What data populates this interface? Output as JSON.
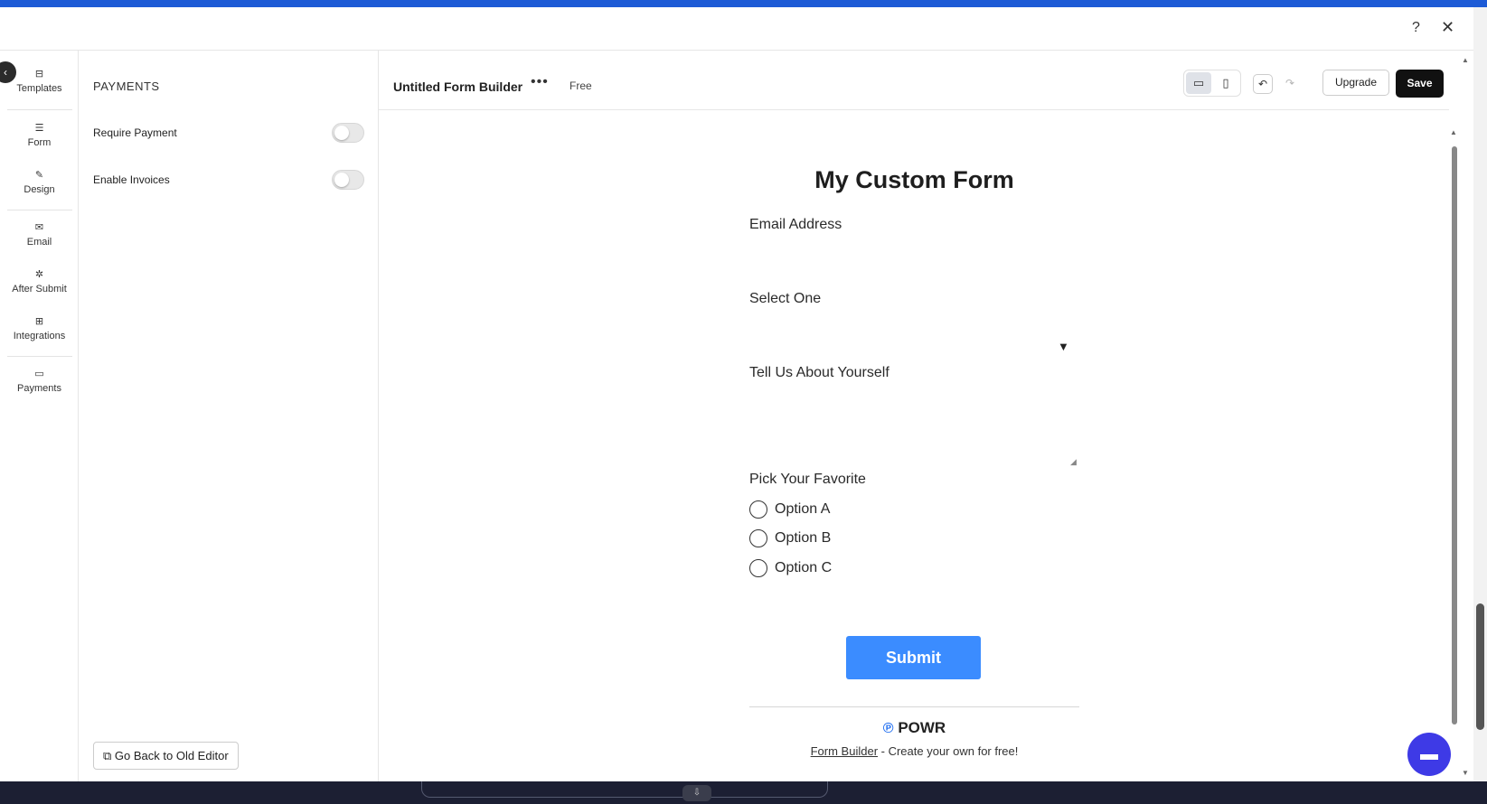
{
  "modal": {
    "help_icon": "?",
    "close_icon": "✕"
  },
  "nav": {
    "items": [
      {
        "label": "Templates",
        "icon": "templates-icon",
        "glyph": "⊟"
      },
      {
        "label": "Form",
        "icon": "form-icon",
        "glyph": "☰"
      },
      {
        "label": "Design",
        "icon": "brush-icon",
        "glyph": "✎"
      },
      {
        "label": "Email",
        "icon": "mail-icon",
        "glyph": "✉"
      },
      {
        "label": "After Submit",
        "icon": "cursor-click-icon",
        "glyph": "✲"
      },
      {
        "label": "Integrations",
        "icon": "integrations-icon",
        "glyph": "⊞"
      },
      {
        "label": "Payments",
        "icon": "card-icon",
        "glyph": "▭"
      }
    ]
  },
  "settings": {
    "title": "PAYMENTS",
    "rows": [
      {
        "label": "Require Payment",
        "enabled": false
      },
      {
        "label": "Enable Invoices",
        "enabled": false
      }
    ],
    "old_editor_label": "Go Back to Old Editor"
  },
  "toolbar": {
    "form_name": "Untitled Form Builder",
    "more": "•••",
    "plan": "Free",
    "upgrade_label": "Upgrade",
    "save_label": "Save"
  },
  "form": {
    "title": "My Custom Form",
    "email_label": "Email Address",
    "select_label": "Select One",
    "about_label": "Tell Us About Yourself",
    "favorite_label": "Pick Your Favorite",
    "options": [
      "Option A",
      "Option B",
      "Option C"
    ],
    "submit_label": "Submit",
    "brand": "POWR",
    "footer_link": "Form Builder",
    "footer_text": " - Create your own for free!"
  },
  "colors": {
    "accent": "#3b8cff",
    "save_button": "#111111",
    "chat_button": "#3e3ae6",
    "top_bar": "#1d5bd6"
  }
}
